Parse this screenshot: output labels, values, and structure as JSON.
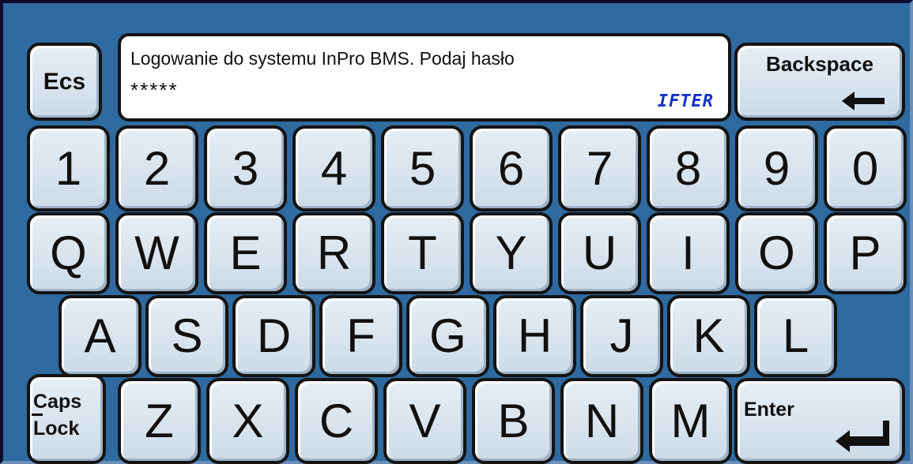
{
  "display": {
    "prompt": "Logowanie do systemu InPro BMS. Podaj hasło",
    "password_mask": "*****",
    "logo_text": "IFTER"
  },
  "keys": {
    "esc": "Ecs",
    "backspace": "Backspace",
    "enter": "Enter",
    "caps_line1": "Caps",
    "caps_line2": "Lock",
    "row_numbers": [
      "1",
      "2",
      "3",
      "4",
      "5",
      "6",
      "7",
      "8",
      "9",
      "0"
    ],
    "row_q": [
      "Q",
      "W",
      "E",
      "R",
      "T",
      "Y",
      "U",
      "I",
      "O",
      "P"
    ],
    "row_a": [
      "A",
      "S",
      "D",
      "F",
      "G",
      "H",
      "J",
      "K",
      "L"
    ],
    "row_z": [
      "Z",
      "X",
      "C",
      "V",
      "B",
      "N",
      "M"
    ]
  },
  "colors": {
    "background": "#2f6aa0",
    "key_face": "#d8e3ee",
    "key_border": "#141414",
    "logo": "#1533c9"
  }
}
